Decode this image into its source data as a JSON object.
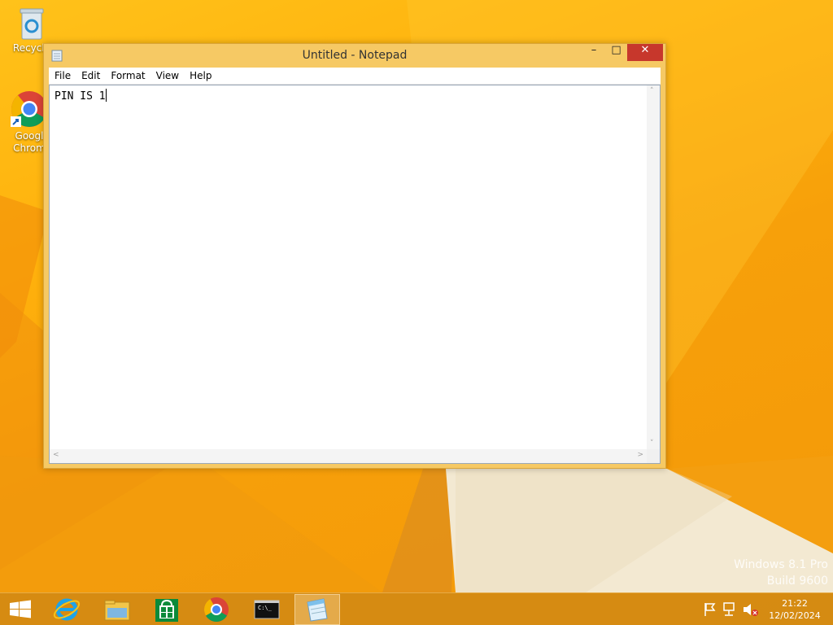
{
  "desktop": {
    "icons": [
      {
        "label": "Recycle",
        "icon": "recycle-bin-icon"
      },
      {
        "label": "Googl\nChrom",
        "icon": "chrome-shortcut-icon"
      }
    ],
    "watermark": {
      "line1": "Windows 8.1 Pro",
      "line2": "Build 9600"
    }
  },
  "notepad": {
    "title": "Untitled - Notepad",
    "controls": {
      "minimize": "–",
      "maximize": "□",
      "close": "✕"
    },
    "menu": [
      "File",
      "Edit",
      "Format",
      "View",
      "Help"
    ],
    "content": "PIN IS 1",
    "accent": "#f6c964",
    "close_color": "#c7372c"
  },
  "taskbar": {
    "apps": [
      {
        "name": "start",
        "icon": "windows-logo-icon",
        "active": false
      },
      {
        "name": "internet-explorer",
        "icon": "internet-explorer-icon",
        "active": false
      },
      {
        "name": "file-explorer",
        "icon": "file-explorer-icon",
        "active": false
      },
      {
        "name": "store",
        "icon": "store-icon",
        "active": false
      },
      {
        "name": "chrome",
        "icon": "chrome-icon",
        "active": false
      },
      {
        "name": "command-prompt",
        "icon": "command-prompt-icon",
        "active": false
      },
      {
        "name": "notepad",
        "icon": "notepad-icon",
        "active": true
      }
    ],
    "tray": [
      "action-center-flag-icon",
      "network-icon",
      "volume-muted-icon"
    ],
    "time": "21:22",
    "date": "12/02/2024",
    "cmd_prompt_text": "C:\\_"
  }
}
